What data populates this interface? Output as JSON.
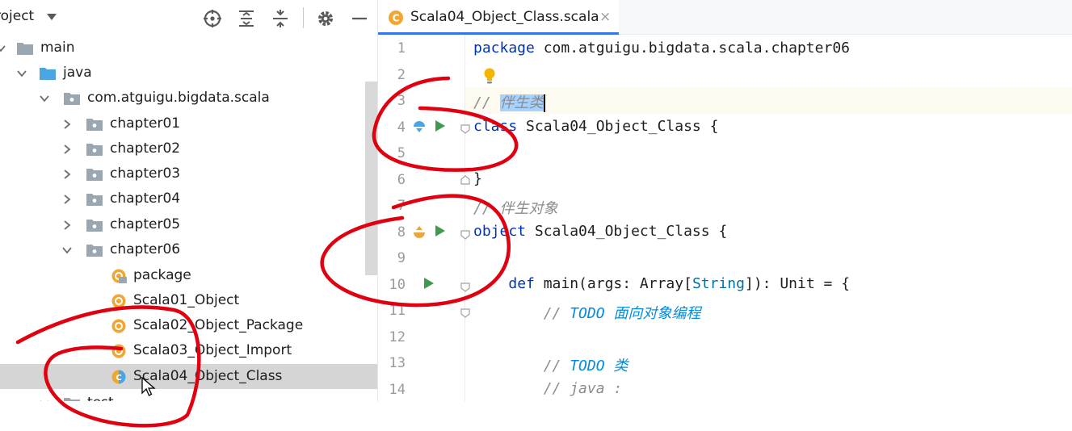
{
  "project_panel": {
    "title": "roject",
    "toolbar": [
      {
        "name": "locate-icon"
      },
      {
        "name": "expand-all-icon"
      },
      {
        "name": "collapse-all-icon"
      },
      {
        "name": "gear-icon"
      },
      {
        "name": "minimize-icon"
      }
    ],
    "tree": [
      {
        "label": "main",
        "icon": "folder-icon",
        "expanded": true
      },
      {
        "label": "java",
        "icon": "source-folder-icon",
        "expanded": true
      },
      {
        "label": "com.atguigu.bigdata.scala",
        "icon": "package-icon",
        "expanded": true
      },
      {
        "label": "chapter01",
        "icon": "package-icon",
        "expanded": false
      },
      {
        "label": "chapter02",
        "icon": "package-icon",
        "expanded": false
      },
      {
        "label": "chapter03",
        "icon": "package-icon",
        "expanded": false
      },
      {
        "label": "chapter04",
        "icon": "package-icon",
        "expanded": false
      },
      {
        "label": "chapter05",
        "icon": "package-icon",
        "expanded": false
      },
      {
        "label": "chapter06",
        "icon": "package-icon",
        "expanded": true
      },
      {
        "label": "package",
        "icon": "package-object-icon"
      },
      {
        "label": "Scala01_Object",
        "icon": "scala-object-icon"
      },
      {
        "label": "Scala02_Object_Package",
        "icon": "scala-object-icon"
      },
      {
        "label": "Scala03_Object_Import",
        "icon": "scala-object-icon"
      },
      {
        "label": "Scala04_Object_Class",
        "icon": "scala-class-object-icon",
        "selected": true
      },
      {
        "label": "test",
        "icon": "folder-icon",
        "expanded": true
      }
    ]
  },
  "editor": {
    "tab": {
      "label": "Scala04_Object_Class.scala",
      "close": "×"
    },
    "line_numbers": [
      "1",
      "2",
      "3",
      "4",
      "5",
      "6",
      "7",
      "8",
      "9",
      "10",
      "11",
      "12",
      "13",
      "14"
    ],
    "code": {
      "l1_kw": "package",
      "l1_rest": " com.atguigu.bigdata.scala.chapter06",
      "l3_prefix": "// ",
      "l3_selected": "伴生类",
      "l4_kw": "class",
      "l4_rest": " Scala04_Object_Class {",
      "l6": "}",
      "l7": "// 伴生对象",
      "l8_kw": "object",
      "l8_rest": " Scala04_Object_Class {",
      "l10_indent": "    ",
      "l10_kw": "def",
      "l10_a": " main(args: Array[",
      "l10_type": "String",
      "l10_b": "]): Unit = {",
      "l11_indent": "        ",
      "l11_prefix": "// ",
      "l11_todo": "TODO",
      "l11_text": " 面向对象编程",
      "l13_indent": "        ",
      "l13_prefix": "// ",
      "l13_todo": "TODO",
      "l13_text": " 类",
      "l14_indent": "        ",
      "l14_text": "// java :"
    }
  },
  "colors": {
    "keyword": "#0033b3",
    "comment": "#8c8c8c",
    "todo": "#008dde",
    "selection": "#a6d2ff",
    "tab_underline": "#3574f0",
    "annotation": "#e0000f"
  }
}
